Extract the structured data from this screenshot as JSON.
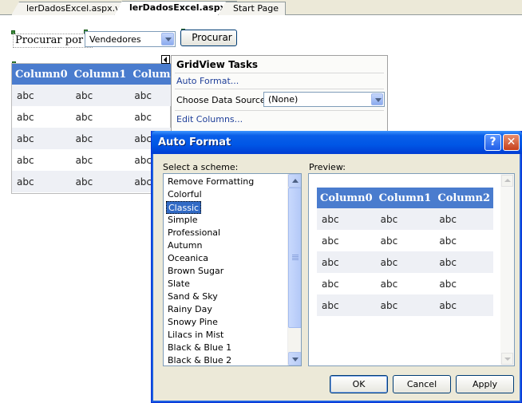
{
  "tabs": [
    {
      "label": "lerDadosExcel.aspx.vb"
    },
    {
      "label": "lerDadosExcel.aspx*"
    },
    {
      "label": "Start Page"
    }
  ],
  "form": {
    "procurar_label": "Procurar por :",
    "select_value": "Vendedores",
    "button_label": "Procurar"
  },
  "grid": {
    "headers": [
      "Column0",
      "Column1",
      "Column2"
    ],
    "rows": [
      [
        "abc",
        "abc",
        "abc"
      ],
      [
        "abc",
        "abc",
        "abc"
      ],
      [
        "abc",
        "abc",
        "abc"
      ],
      [
        "abc",
        "abc",
        "abc"
      ],
      [
        "abc",
        "abc",
        "abc"
      ]
    ],
    "header_color": "#4a7cce",
    "alt_row_color": "#eef0f5"
  },
  "tasks": {
    "title": "GridView Tasks",
    "auto_format": "Auto Format...",
    "choose_ds_label": "Choose Data Source:",
    "choose_ds_value": "(None)",
    "edit_columns": "Edit Columns..."
  },
  "dialog": {
    "title": "Auto Format",
    "help_glyph": "?",
    "close_glyph": "✕",
    "scheme_label": "Select a scheme:",
    "preview_label": "Preview:",
    "schemes": [
      "Remove Formatting",
      "Colorful",
      "Classic",
      "Simple",
      "Professional",
      "Autumn",
      "Oceanica",
      "Brown Sugar",
      "Slate",
      "Sand & Sky",
      "Rainy Day",
      "Snowy Pine",
      "Lilacs in Mist",
      "Black & Blue 1",
      "Black & Blue 2"
    ],
    "selected_scheme": "Classic",
    "ok": "OK",
    "cancel": "Cancel",
    "apply": "Apply"
  }
}
